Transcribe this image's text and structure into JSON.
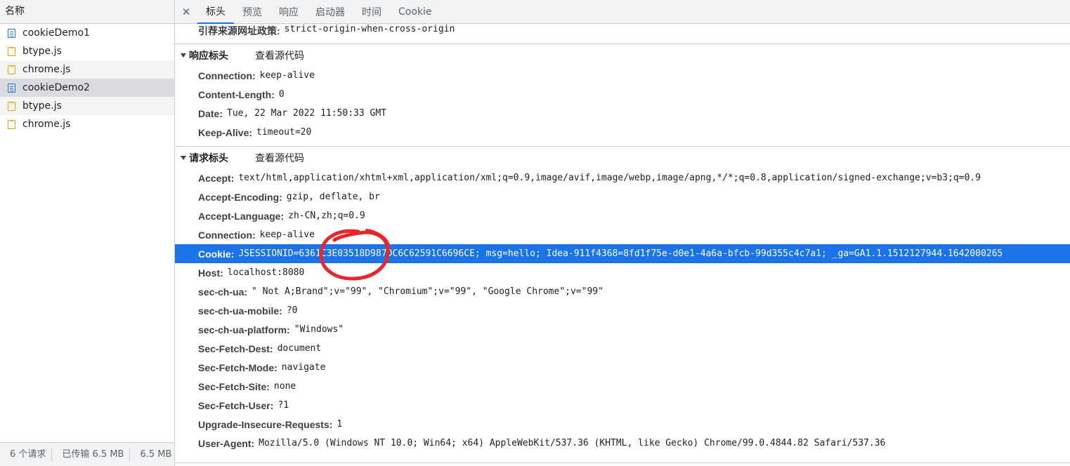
{
  "left_panel": {
    "header": "名称",
    "items": [
      {
        "name": "cookieDemo1",
        "type": "doc"
      },
      {
        "name": "btype.js",
        "type": "js"
      },
      {
        "name": "chrome.js",
        "type": "js"
      },
      {
        "name": "cookieDemo2",
        "type": "doc"
      },
      {
        "name": "btype.js",
        "type": "js"
      },
      {
        "name": "chrome.js",
        "type": "js"
      }
    ],
    "footer": {
      "requests": "6 个请求",
      "transferred": "已传输 6.5 MB",
      "resources": "6.5 MB"
    }
  },
  "tabs": {
    "close_glyph": "✕",
    "items": [
      "标头",
      "预览",
      "响应",
      "启动器",
      "时间",
      "Cookie"
    ],
    "active": "标头"
  },
  "referrer_policy": {
    "key": "引荐来源网址政策:",
    "value": "strict-origin-when-cross-origin"
  },
  "response_headers": {
    "title": "响应标头",
    "view_source": "查看源代码",
    "rows": [
      {
        "key": "Connection:",
        "value": "keep-alive"
      },
      {
        "key": "Content-Length:",
        "value": "0"
      },
      {
        "key": "Date:",
        "value": "Tue, 22 Mar 2022 11:50:33 GMT"
      },
      {
        "key": "Keep-Alive:",
        "value": "timeout=20"
      }
    ]
  },
  "request_headers": {
    "title": "请求标头",
    "view_source": "查看源代码",
    "rows": [
      {
        "key": "Accept:",
        "value": "text/html,application/xhtml+xml,application/xml;q=0.9,image/avif,image/webp,image/apng,*/*;q=0.8,application/signed-exchange;v=b3;q=0.9"
      },
      {
        "key": "Accept-Encoding:",
        "value": "gzip, deflate, br"
      },
      {
        "key": "Accept-Language:",
        "value": "zh-CN,zh;q=0.9"
      },
      {
        "key": "Connection:",
        "value": "keep-alive"
      },
      {
        "key": "Cookie:",
        "value": "JSESSIONID=6361C3E03518D987DC6C62591C6696CE; msg=hello; Idea-911f4368=8fd1f75e-d0e1-4a6a-bfcb-99d355c4c7a1; _ga=GA1.1.1512127944.1642000265",
        "highlight": true
      },
      {
        "key": "Host:",
        "value": "localhost:8080"
      },
      {
        "key": "sec-ch-ua:",
        "value": "\" Not A;Brand\";v=\"99\", \"Chromium\";v=\"99\", \"Google Chrome\";v=\"99\""
      },
      {
        "key": "sec-ch-ua-mobile:",
        "value": "?0"
      },
      {
        "key": "sec-ch-ua-platform:",
        "value": "\"Windows\""
      },
      {
        "key": "Sec-Fetch-Dest:",
        "value": "document"
      },
      {
        "key": "Sec-Fetch-Mode:",
        "value": "navigate"
      },
      {
        "key": "Sec-Fetch-Site:",
        "value": "none"
      },
      {
        "key": "Sec-Fetch-User:",
        "value": "?1"
      },
      {
        "key": "Upgrade-Insecure-Requests:",
        "value": "1"
      },
      {
        "key": "User-Agent:",
        "value": "Mozilla/5.0 (Windows NT 10.0; Win64; x64) AppleWebKit/537.36 (KHTML, like Gecko) Chrome/99.0.4844.82 Safari/537.36"
      }
    ]
  },
  "colors": {
    "accent": "#1a73e8",
    "annotation": "#e8262b",
    "border": "#cbcdd1"
  }
}
